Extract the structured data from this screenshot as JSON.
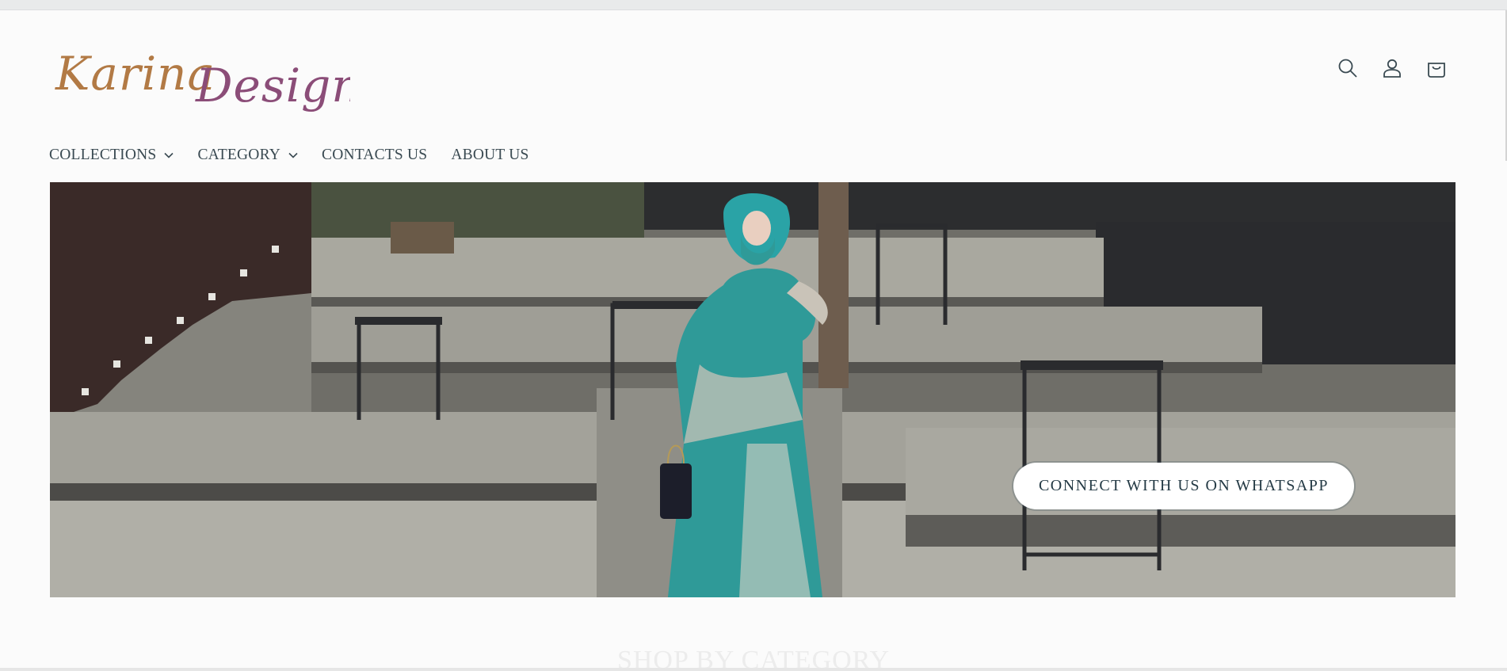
{
  "brand": {
    "logo_part1": "Karina",
    "logo_part2": "Design",
    "logo_color1": "#b27a45",
    "logo_color2": "#8b4d78"
  },
  "header_icons": [
    {
      "name": "search-icon",
      "label": "search"
    },
    {
      "name": "account-icon",
      "label": "account"
    },
    {
      "name": "cart-icon",
      "label": "cart"
    }
  ],
  "nav": {
    "items": [
      {
        "label": "COLLECTIONS",
        "has_dropdown": true
      },
      {
        "label": "CATEGORY",
        "has_dropdown": true
      },
      {
        "label": "CONTACTS US",
        "has_dropdown": false
      },
      {
        "label": "ABOUT US",
        "has_dropdown": false
      }
    ]
  },
  "hero": {
    "cta_label": "CONNECT WITH US ON WHATSAPP",
    "dress_color": "#2f9a98",
    "concrete_color": "#8e8d86"
  },
  "next_section": {
    "heading": "SHOP BY CATEGORY"
  }
}
